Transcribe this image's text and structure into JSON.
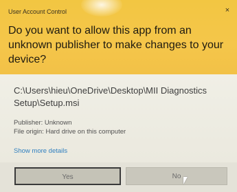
{
  "window": {
    "title": "User Account Control",
    "close_glyph": "×"
  },
  "prompt": {
    "question": "Do you want to allow this app from an unknown publisher to make changes to your device?"
  },
  "details": {
    "file_path": "C:\\Users\\hieu\\OneDrive\\Desktop\\MII Diagnostics Setup\\Setup.msi",
    "publisher": "Publisher: Unknown",
    "file_origin": "File origin: Hard drive on this computer",
    "more_details_link": "Show more details"
  },
  "buttons": {
    "yes_label": "Yes",
    "no_label": "No"
  },
  "colors": {
    "header": "#f4c545",
    "link": "#2f7fbf",
    "body": "#ebe8dc"
  },
  "icons": {
    "close": "close-icon",
    "cursor": "mouse-pointer-icon"
  }
}
